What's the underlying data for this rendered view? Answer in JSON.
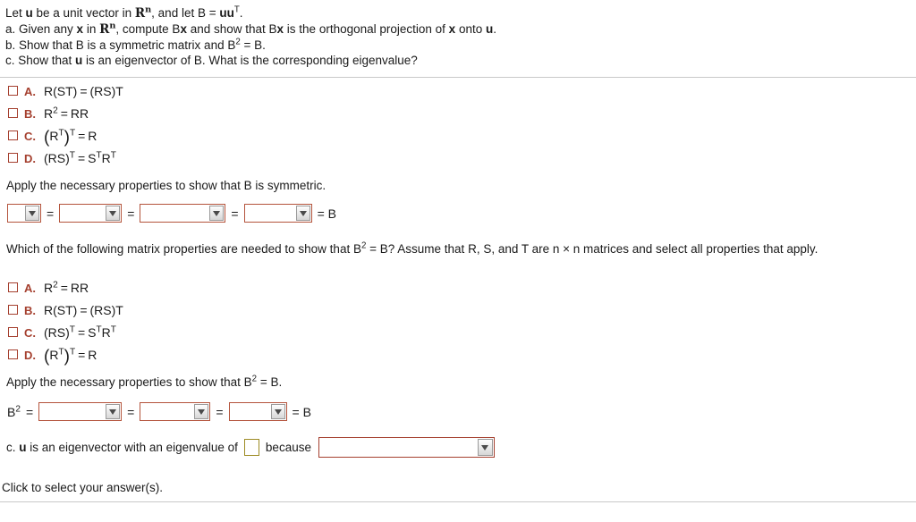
{
  "problem": {
    "line1_a": "Let ",
    "line1_u": "u",
    "line1_b": " be a unit vector in ",
    "line1_r": "R",
    "line1_n": "n",
    "line1_c": ", and let B = ",
    "line1_uu": "uu",
    "line1_t": "T",
    "line1_d": ".",
    "line2_a": "a. Given any ",
    "line2_x": "x",
    "line2_b": " in ",
    "line2_r": "R",
    "line2_n": "n",
    "line2_c": ", compute B",
    "line2_x2": "x",
    "line2_d": " and show that B",
    "line2_x3": "x",
    "line2_e": " is the orthogonal projection of ",
    "line2_x4": "x",
    "line2_f": " onto ",
    "line2_u": "u",
    "line2_g": ".",
    "line3_a": "b. Show that B is a symmetric matrix and B",
    "line3_sup": "2",
    "line3_b": " = B.",
    "line4": "c. Show that ",
    "line4_u": "u",
    "line4_b": " is an eigenvector of B. What is the corresponding eigenvalue?"
  },
  "choices_1": [
    {
      "label": "A.",
      "kind": "rst",
      "text": "R(ST) = (RS)T"
    },
    {
      "label": "B.",
      "kind": "rsq",
      "text": "R2 = RR"
    },
    {
      "label": "C.",
      "kind": "rtt",
      "text": "(RT)T = R"
    },
    {
      "label": "D.",
      "kind": "rst_t",
      "text": "(RS)T = STRT"
    }
  ],
  "choices_2": [
    {
      "label": "A.",
      "kind": "rsq",
      "text": "R2 = RR"
    },
    {
      "label": "B.",
      "kind": "rst",
      "text": "R(ST) = (RS)T"
    },
    {
      "label": "C.",
      "kind": "rst_t",
      "text": "(RS)T = STRT"
    },
    {
      "label": "D.",
      "kind": "rtt",
      "text": "(RT)T = R"
    }
  ],
  "prompt_symmetric": "Apply the necessary properties to show that B is symmetric.",
  "question_2": {
    "a": "Which of the following matrix properties are needed to show that B",
    "sup": "2",
    "b": " = B? Assume that R, S, and T are n × n matrices and select all properties that apply."
  },
  "prompt_bsq": {
    "a": "Apply the necessary properties to show that B",
    "sup": "2",
    "b": " = B."
  },
  "row_symmetric": {
    "widths": [
      38,
      70,
      96,
      76
    ],
    "eq": "=",
    "tail": "= B",
    "values": [
      "",
      "",
      "",
      ""
    ]
  },
  "row_bsq": {
    "lead_b": "B",
    "lead_sup": "2",
    "lead_eq": "=",
    "widths": [
      93,
      79,
      65
    ],
    "eq": "=",
    "tail": "= B",
    "values": [
      "",
      "",
      ""
    ]
  },
  "eigen_row": {
    "prefix_a": "c. ",
    "prefix_u": "u",
    "prefix_b": " is an eigenvector with an eigenvalue of",
    "eigen_value": "",
    "because": "because",
    "reason_value": ""
  },
  "footer": "Click to select your answer(s).",
  "colors": {
    "accent_red": "#a5402f",
    "dropdown_border": "#b4543c",
    "eigen_border": "#9d8b24",
    "rule": "#c9c9c9"
  }
}
